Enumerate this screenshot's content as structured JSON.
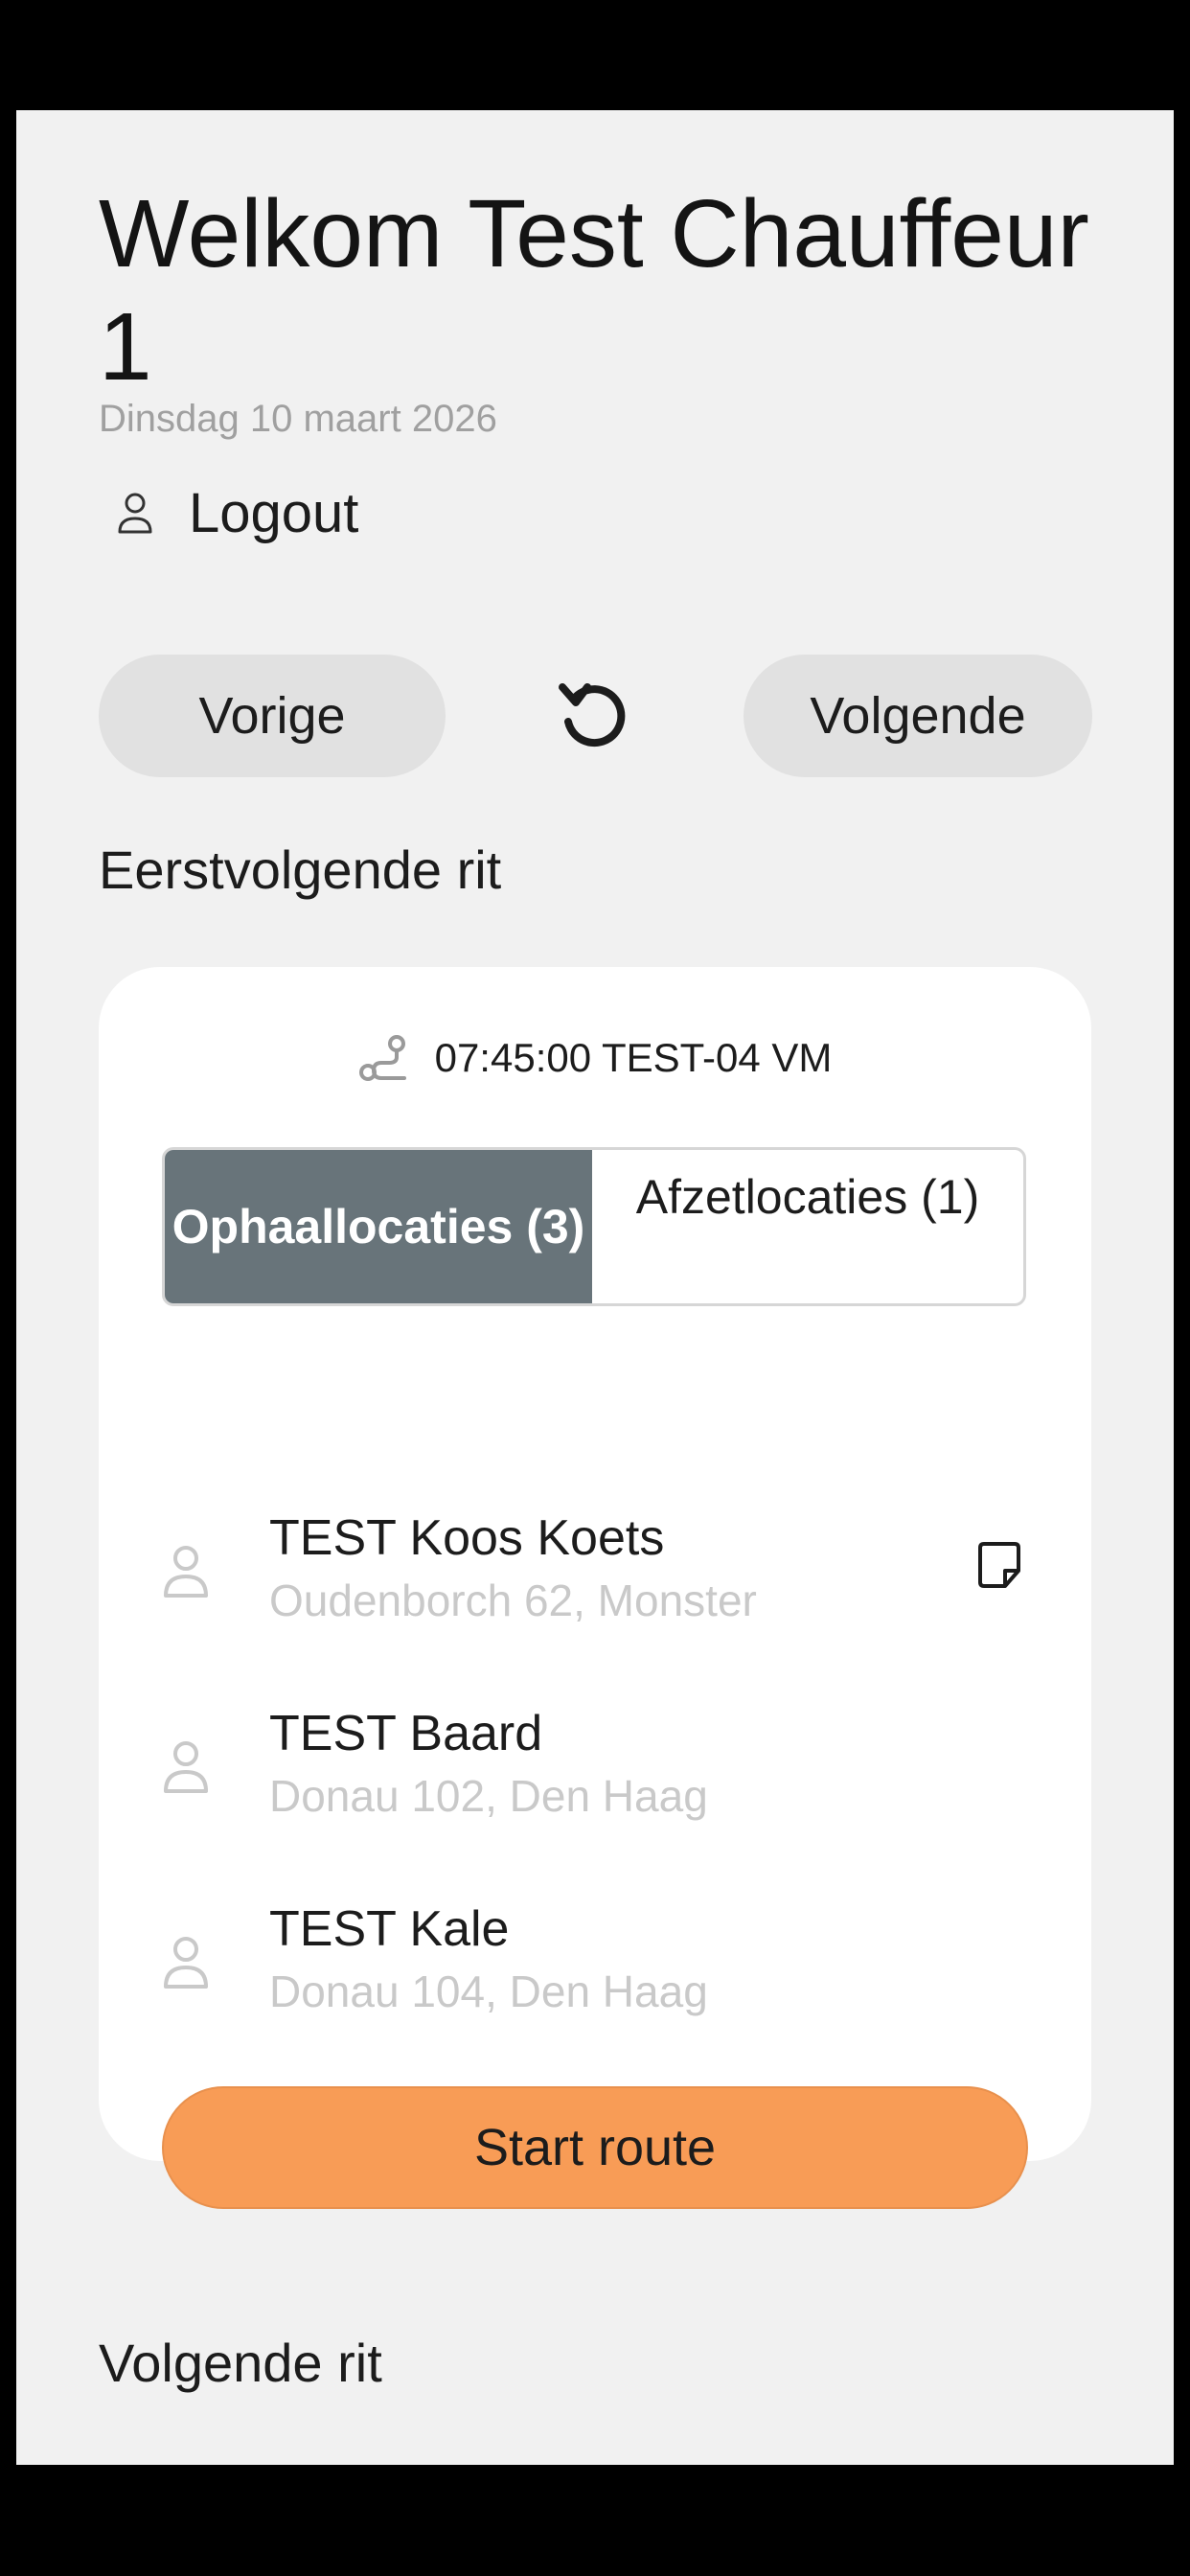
{
  "header": {
    "welcome": "Welkom Test Chauffeur 1",
    "date": "Dinsdag 10 maart 2026",
    "logout_label": "Logout",
    "logout_icon": "person-icon"
  },
  "nav": {
    "prev_label": "Vorige",
    "next_label": "Volgende",
    "refresh_icon": "refresh-icon"
  },
  "first_trip": {
    "section_title": "Eerstvolgende rit",
    "trip_icon": "route-icon",
    "trip_label": "07:45:00 TEST-04 VM",
    "tabs": [
      {
        "label": "Ophaallocaties (3)",
        "active": true
      },
      {
        "label": "Afzetlocaties (1)",
        "active": false
      }
    ],
    "passengers": [
      {
        "name": "TEST Koos Koets",
        "address": "Oudenborch 62, Monster",
        "has_note": true
      },
      {
        "name": "TEST Baard",
        "address": "Donau 102, Den Haag",
        "has_note": false
      },
      {
        "name": "TEST Kale",
        "address": "Donau 104, Den Haag",
        "has_note": false
      }
    ],
    "start_label": "Start route"
  },
  "next_trip": {
    "section_title": "Volgende rit"
  },
  "colors": {
    "accent": "#f89c56",
    "active_tab": "#68747a",
    "background": "#f1f1f1",
    "pill": "#e1e1e1"
  }
}
